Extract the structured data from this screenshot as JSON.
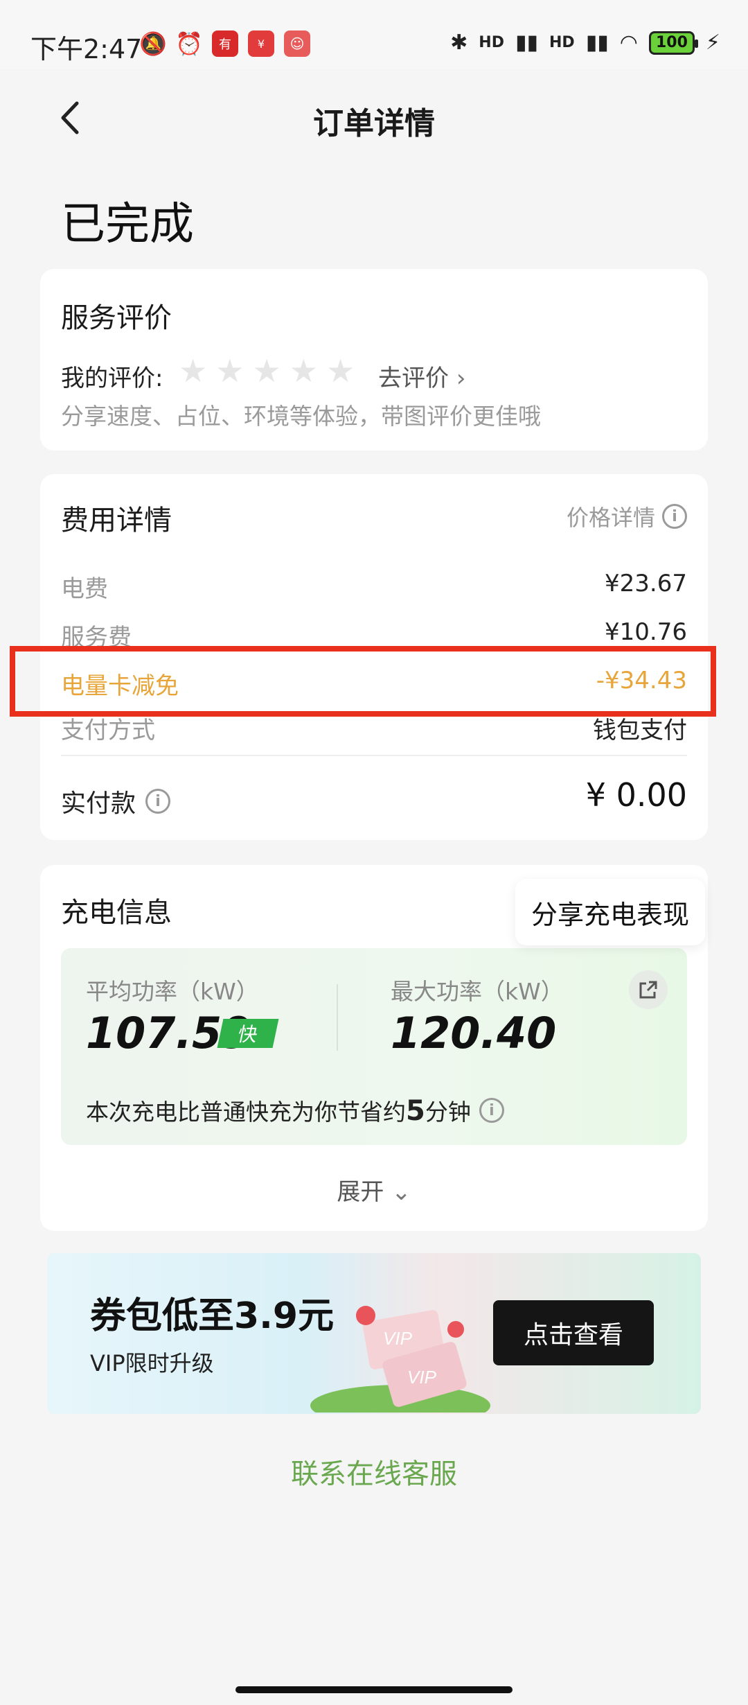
{
  "status_bar": {
    "time": "下午2:47",
    "battery": "100",
    "signal_label": "HD"
  },
  "header": {
    "title": "订单详情"
  },
  "order_status": "已完成",
  "rating": {
    "title": "服务评价",
    "my_rating_label": "我的评价:",
    "stars": 0,
    "go_rate": "去评价",
    "hint": "分享速度、占位、环境等体验，带图评价更佳哦"
  },
  "fees": {
    "title": "费用详情",
    "price_detail": "价格详情",
    "rows": [
      {
        "key": "电费",
        "value": "¥23.67"
      },
      {
        "key": "服务费",
        "value": "¥10.76"
      },
      {
        "key": "电量卡减免",
        "value": "-¥34.43"
      },
      {
        "key": "支付方式",
        "value": "钱包支付"
      }
    ],
    "paid_label": "实付款",
    "paid_value": "¥ 0.00"
  },
  "charging": {
    "title": "充电信息",
    "share_tip": "分享充电表现",
    "avg_label": "平均功率（kW）",
    "avg_value": "107.59",
    "fast_badge": "快",
    "max_label": "最大功率（kW）",
    "max_value": "120.40",
    "save_prefix": "本次充电比普通快充为你节省约",
    "save_minutes": "5",
    "save_suffix": "分钟",
    "expand": "展开"
  },
  "promo": {
    "title": "券包低至3.9元",
    "subtitle": "VIP限时升级",
    "button": "点击查看",
    "art_text_1": "VIP",
    "art_text_2": "VIP"
  },
  "contact": "联系在线客服",
  "colors": {
    "accent_gold": "#e7a53a",
    "highlight_red": "#e8301c",
    "contact_green": "#6aa84f",
    "fast_green": "#2fb24a"
  }
}
